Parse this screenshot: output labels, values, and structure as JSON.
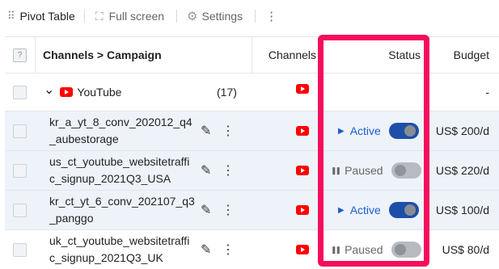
{
  "toolbar": {
    "pivot_label": "Pivot Table",
    "fullscreen_label": "Full screen",
    "settings_label": "Settings",
    "more_glyph": "⋮"
  },
  "table": {
    "headers": {
      "select_all": "?",
      "campaign": "Channels > Campaign",
      "channels": "Channels",
      "status": "Status",
      "budget": "Budget"
    },
    "group": {
      "name": "YouTube",
      "count": "(17)",
      "budget": "-",
      "expand_glyph": "⌄"
    },
    "rows": [
      {
        "name": "kr_a_yt_8_conv_202012_q4_aubestorage",
        "status": "Active",
        "enabled": true,
        "budget": "US$ 200/d"
      },
      {
        "name": "us_ct_youtube_websitetraffic_signup_2021Q3_USA",
        "status": "Paused",
        "enabled": false,
        "budget": "US$ 220/d"
      },
      {
        "name": "kr_ct_yt_6_conv_202107_q3_panggo",
        "status": "Active",
        "enabled": true,
        "budget": "US$ 100/d"
      },
      {
        "name": "uk_ct_youtube_websitetraffic_signup_2021Q3_UK",
        "status": "Paused",
        "enabled": false,
        "budget": "US$ 80/d"
      }
    ]
  },
  "icons": {
    "edit": "✎",
    "more": "⋮",
    "play": "▶",
    "pause": "❚❚"
  },
  "colors": {
    "highlight": "#f50d5c",
    "active": "#1d5dcc",
    "toggle_on": "#1e4fa8",
    "youtube": "#ff0000",
    "subrow_bg": "#eef3fa"
  }
}
